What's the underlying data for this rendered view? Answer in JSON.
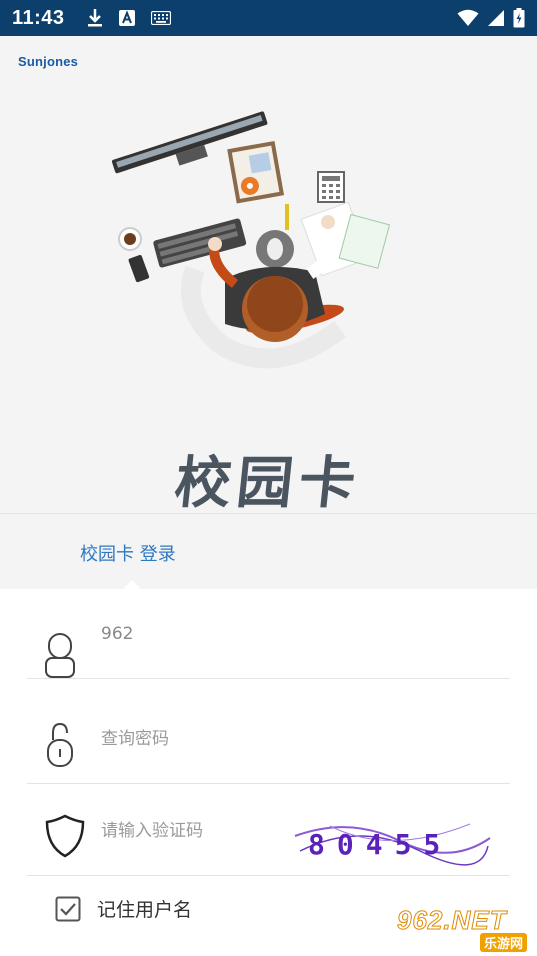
{
  "status_bar": {
    "time": "11:43",
    "left_icons": [
      "download-icon",
      "font-a-icon",
      "keyboard-icon"
    ],
    "right_icons": [
      "wifi-icon",
      "signal-icon",
      "battery-icon"
    ],
    "bg_color": "#0d3f6d"
  },
  "header": {
    "logo_text": "Sunjones"
  },
  "hero": {
    "app_title": "校园卡"
  },
  "tabs": {
    "login_label": "校园卡 登录",
    "accent_color": "#2e78c2"
  },
  "form": {
    "username": {
      "value": "962",
      "icon": "user-icon"
    },
    "password": {
      "placeholder": "查询密码",
      "icon": "lock-icon"
    },
    "captcha": {
      "placeholder": "请输入验证码",
      "icon": "shield-icon",
      "image_text": "80455"
    },
    "remember": {
      "label": "记住用户名",
      "checked": true
    }
  },
  "watermark": {
    "main": "962.NET",
    "sub": "乐游网"
  }
}
